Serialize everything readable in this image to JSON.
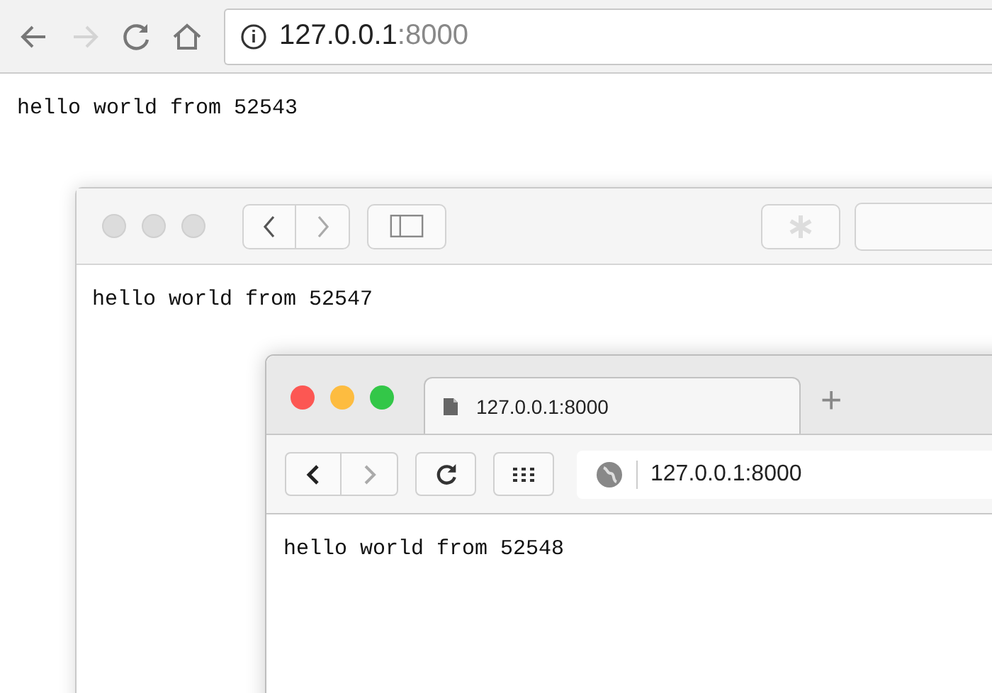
{
  "back_window": {
    "back_disabled": false,
    "forward_disabled": true,
    "address": {
      "host": "127.0.0.1",
      "port": ":8000"
    },
    "body_text": "hello world from 52543"
  },
  "middle_window": {
    "back_disabled": false,
    "forward_disabled": true,
    "body_text": "hello world from 52547"
  },
  "front_window": {
    "tabs": [
      {
        "title": "127.0.0.1:8000",
        "selected": true
      }
    ],
    "new_tab": "+",
    "back_disabled": false,
    "forward_disabled": true,
    "address": "127.0.0.1:8000",
    "body_text": "hello world from 52548"
  }
}
